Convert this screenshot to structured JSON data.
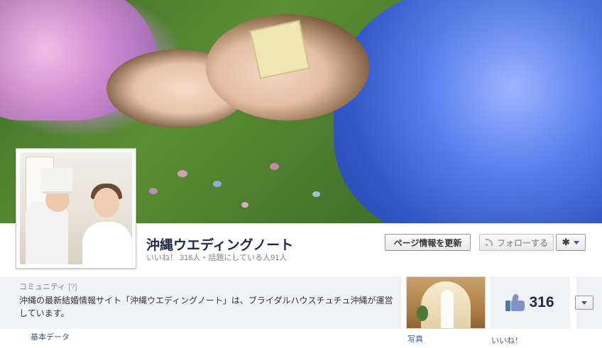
{
  "cover": {
    "description_icon": "cover-photo"
  },
  "page": {
    "name": "沖縄ウエディングノート",
    "stats": "いいね！ 316人・話題にしている人91人"
  },
  "buttons": {
    "update_page": "ページ情報を更新",
    "follow": "フォローする",
    "settings_icon": "gear-icon"
  },
  "about": {
    "category": "コミュニティ",
    "help": "[?]",
    "description": "沖縄の最新結婚情報サイト「沖縄ウエディングノート」は、ブライダルハウスチュチュ沖縄が運営しています。",
    "basic_data_link": "基本データ"
  },
  "apps": {
    "photos_label": "写真",
    "likes_count": "316",
    "likes_label": "いいね！"
  },
  "colors": {
    "link": "#3b5998",
    "title": "#1c2a47",
    "strip_bg": "#f1f2f6"
  }
}
